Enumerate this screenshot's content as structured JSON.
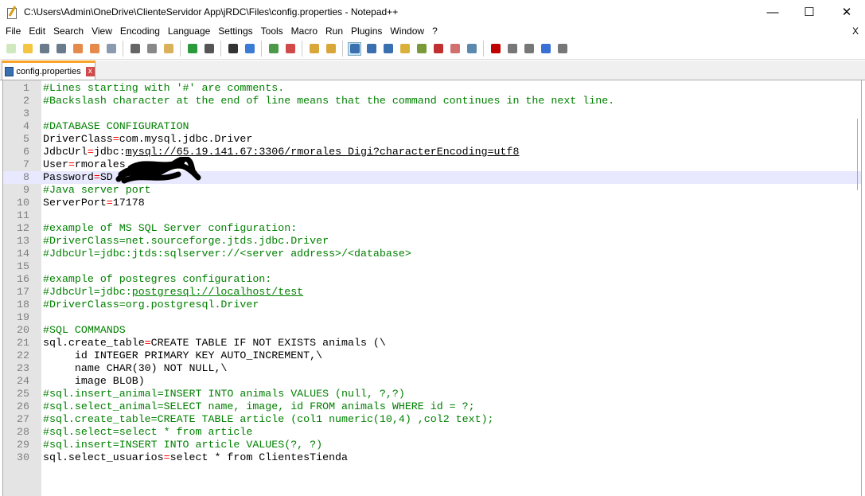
{
  "window": {
    "title": "C:\\Users\\Admin\\OneDrive\\ClienteServidor App\\jRDC\\Files\\config.properties - Notepad++",
    "minimize": "—",
    "maximize": "☐",
    "close": "✕"
  },
  "menu": {
    "items": [
      "File",
      "Edit",
      "Search",
      "View",
      "Encoding",
      "Language",
      "Settings",
      "Tools",
      "Macro",
      "Run",
      "Plugins",
      "Window",
      "?"
    ],
    "close": "X"
  },
  "toolbar": {
    "icons": [
      "new-file",
      "open-file",
      "save",
      "save-all",
      "close",
      "close-all",
      "print",
      "|",
      "cut",
      "copy",
      "paste",
      "|",
      "undo",
      "redo",
      "|",
      "find",
      "replace",
      "|",
      "zoom-in",
      "zoom-out",
      "|",
      "sync-vertical",
      "sync-horizontal",
      "|",
      "word-wrap",
      "show-all-chars",
      "indent-guide",
      "user-defined-language",
      "document-map",
      "function-list",
      "folder-as-workspace",
      "monitoring",
      "|",
      "record-macro",
      "stop-recording",
      "play-macro",
      "run-macro-multiple",
      "save-macro"
    ]
  },
  "tab": {
    "label": "config.properties",
    "close": "x"
  },
  "editor": {
    "current_line": 8,
    "lines": [
      {
        "c": "#Lines starting with '#' are comments."
      },
      {
        "c": "#Backslash character at the end of line means that the command continues in the next line."
      },
      {},
      {
        "c": "#DATABASE CONFIGURATION"
      },
      {
        "k": "DriverClass",
        "v": "com.mysql.jdbc.Driver"
      },
      {
        "k": "JdbcUrl",
        "v": "jdbc:",
        "u": "mysql://65.19.141.67:3306/rmorales_Digi?characterEncoding=utf8"
      },
      {
        "k": "User",
        "v": "rmorales"
      },
      {
        "k": "Password",
        "v": "SD"
      },
      {
        "c": "#Java server port"
      },
      {
        "k": "ServerPort",
        "v": "17178"
      },
      {},
      {
        "c": "#example of MS SQL Server configuration:"
      },
      {
        "c": "#DriverClass=net.sourceforge.jtds.jdbc.Driver"
      },
      {
        "c": "#JdbcUrl=jdbc:jtds:sqlserver://<server address>/<database>"
      },
      {},
      {
        "c": "#example of postegres configuration:"
      },
      {
        "c": "#JdbcUrl=jdbc:",
        "cu": "postgresql://localhost/test"
      },
      {
        "c": "#DriverClass=org.postgresql.Driver"
      },
      {},
      {
        "c": "#SQL COMMANDS"
      },
      {
        "k": "sql.create_table",
        "v": "CREATE TABLE IF NOT EXISTS animals (\\"
      },
      {
        "k": "     id INTEGER PRIMARY KEY AUTO_INCREMENT,\\"
      },
      {
        "k": "     name CHAR(30) NOT NULL,\\"
      },
      {
        "k": "     image BLOB)"
      },
      {
        "c": "#sql.insert_animal=INSERT INTO animals VALUES (null, ?,?)"
      },
      {
        "c": "#sql.select_animal=SELECT name, image, id FROM animals WHERE id = ?;"
      },
      {
        "c": "#sql.create_table=CREATE TABLE article (col1 numeric(10,4) ,col2 text);"
      },
      {
        "c": "#sql.select=select * from article"
      },
      {
        "c": "#sql.insert=INSERT INTO article VALUES(?, ?)"
      },
      {
        "k": "sql.select_usuarios",
        "v": "select * from ClientesTienda"
      }
    ]
  }
}
